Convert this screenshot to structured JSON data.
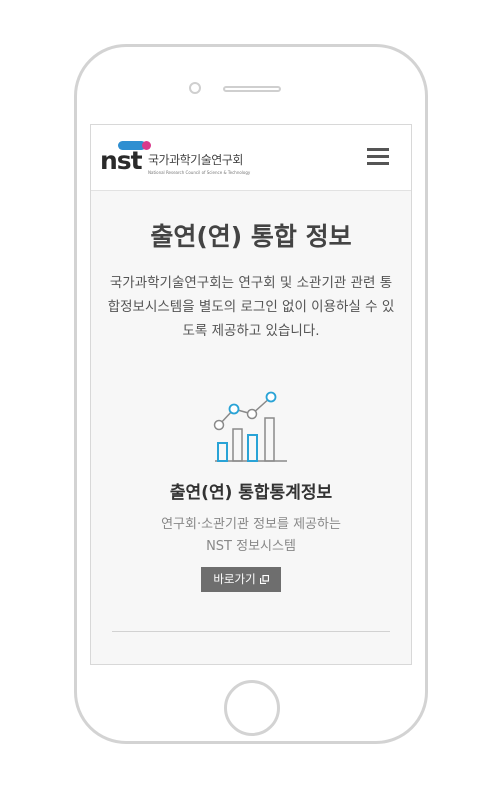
{
  "header": {
    "logo_text": "nst",
    "logo_org_kr": "국가과학기술연구회",
    "logo_org_en": "National Research Council of Science & Technology",
    "menu_icon": "hamburger-menu-icon"
  },
  "main": {
    "title": "출연(연) 통합 정보",
    "description": "국가과학기술연구회는 연구회 및 소관기관 관련 통합정보시스템을 별도의 로그인 없이 이용하실 수 있도록 제공하고 있습니다.",
    "service": {
      "icon": "bar-line-chart-icon",
      "title": "출연(연) 통합통계정보",
      "desc_line1": "연구회·소관기관 정보를 제공하는",
      "desc_line2": "NST 정보시스템",
      "button_label": "바로가기",
      "button_icon": "external-link-icon"
    }
  },
  "colors": {
    "accent_blue": "#2f8fd1",
    "accent_pink": "#d93a8c",
    "button_bg": "#6e6e6e",
    "chart_cyan": "#29a3d6"
  }
}
